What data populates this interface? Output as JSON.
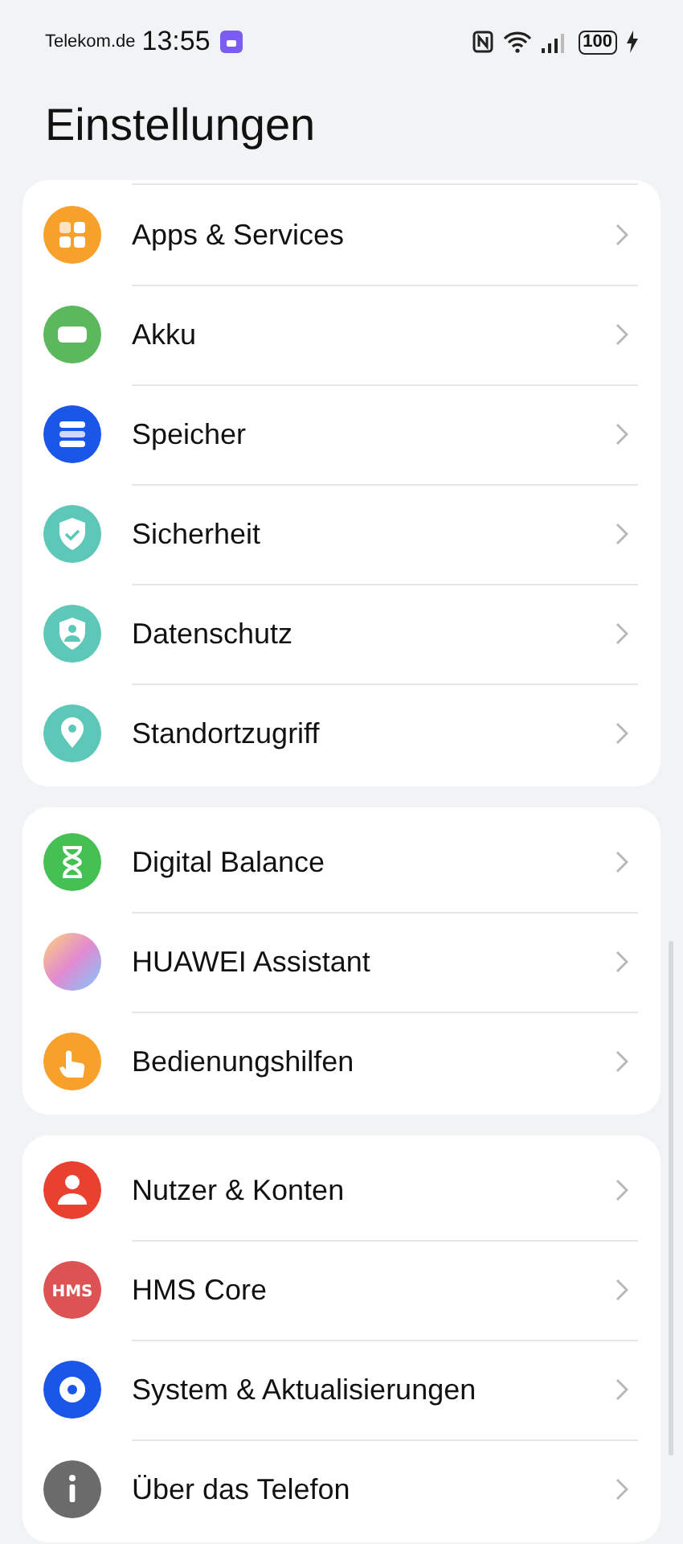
{
  "status_bar": {
    "carrier": "Telekom.de",
    "time": "13:55",
    "battery": "100"
  },
  "title": "Einstellungen",
  "groups": [
    {
      "items": [
        {
          "label": "Apps & Services",
          "color": "#f7a02a"
        },
        {
          "label": "Akku",
          "color": "#5cb85c"
        },
        {
          "label": "Speicher",
          "color": "#1a56e8"
        },
        {
          "label": "Sicherheit",
          "color": "#5ec8b8"
        },
        {
          "label": "Datenschutz",
          "color": "#5ec8b8"
        },
        {
          "label": "Standortzugriff",
          "color": "#5ec8b8"
        }
      ]
    },
    {
      "items": [
        {
          "label": "Digital Balance",
          "color": "#45c153"
        },
        {
          "label": "HUAWEI Assistant",
          "color": "#e28ad0"
        },
        {
          "label": "Bedienungshilfen",
          "color": "#f7a02a"
        }
      ]
    },
    {
      "items": [
        {
          "label": "Nutzer & Konten",
          "color": "#e8412f"
        },
        {
          "label": "HMS Core",
          "color": "#dd5252",
          "icon_text": "HMS"
        },
        {
          "label": "System & Aktualisierungen",
          "color": "#1a56e8"
        },
        {
          "label": "Über das Telefon",
          "color": "#6b6b6b"
        }
      ]
    }
  ]
}
